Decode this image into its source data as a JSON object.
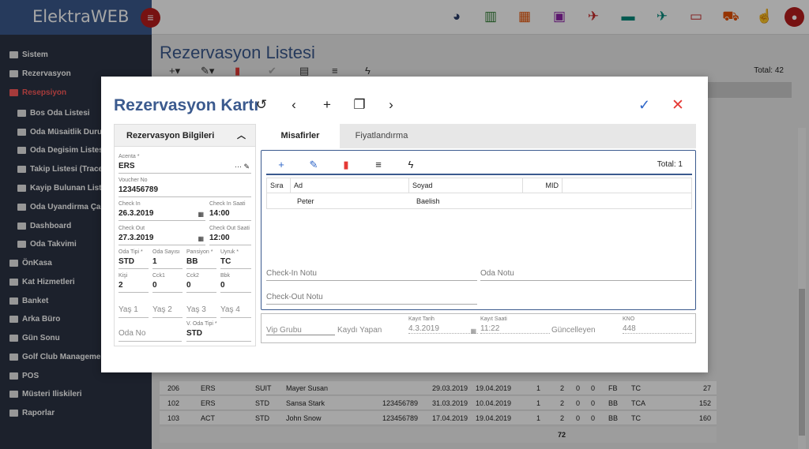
{
  "app": {
    "brand": "ElektraWEB"
  },
  "sidebar": {
    "items": [
      {
        "label": "Sistem"
      },
      {
        "label": "Rezervasyon"
      },
      {
        "label": "Resepsiyon"
      },
      {
        "label": "Bos Oda Listesi"
      },
      {
        "label": "Oda Müsaitlik Durumu"
      },
      {
        "label": "Oda Degisim Listesi"
      },
      {
        "label": "Takip Listesi (Trace)"
      },
      {
        "label": "Kayip Bulunan Listesi"
      },
      {
        "label": "Oda Uyandirma Çagrisi"
      },
      {
        "label": "Dashboard"
      },
      {
        "label": "Oda Takvimi"
      },
      {
        "label": "ÖnKasa"
      },
      {
        "label": "Kat Hizmetleri"
      },
      {
        "label": "Banket"
      },
      {
        "label": "Arka Büro"
      },
      {
        "label": "Gün Sonu"
      },
      {
        "label": "Golf Club Management"
      },
      {
        "label": "POS"
      },
      {
        "label": "Müsteri Iliskileri"
      },
      {
        "label": "Raporlar"
      }
    ]
  },
  "main": {
    "title": "Rezervasyon Listesi",
    "total": "Total: 42",
    "sum": "72"
  },
  "bg_rows": [
    {
      "c1": "206",
      "c2": "ERS",
      "c3": "SUIT",
      "c4": "Mayer Susan",
      "c5": "",
      "c6": "29.03.2019",
      "c7": "19.04.2019",
      "c8": "1",
      "c9": "2",
      "c10": "0",
      "c11": "0",
      "c12": "FB",
      "c13": "TC",
      "c14": "27"
    },
    {
      "c1": "102",
      "c2": "ERS",
      "c3": "STD",
      "c4": "Sansa Stark",
      "c5": "123456789",
      "c6": "31.03.2019",
      "c7": "10.04.2019",
      "c8": "1",
      "c9": "2",
      "c10": "0",
      "c11": "0",
      "c12": "BB",
      "c13": "TCA",
      "c14": "152"
    },
    {
      "c1": "103",
      "c2": "ACT",
      "c3": "STD",
      "c4": "John Snow",
      "c5": "123456789",
      "c6": "17.04.2019",
      "c7": "19.04.2019",
      "c8": "1",
      "c9": "2",
      "c10": "0",
      "c11": "0",
      "c12": "BB",
      "c13": "TC",
      "c14": "160"
    }
  ],
  "modal": {
    "title": "Rezervasyon Kartı",
    "left_panel": {
      "header": "Rezervasyon Bilgileri",
      "acenta_label": "Acenta *",
      "acenta": "ERS",
      "voucher_label": "Voucher No",
      "voucher": "123456789",
      "checkin_label": "Check In",
      "checkin": "26.3.2019",
      "checkin_time_label": "Check In Saati",
      "checkin_time": "14:00",
      "checkout_label": "Check Out",
      "checkout": "27.3.2019",
      "checkout_time_label": "Check Out Saati",
      "checkout_time": "12:00",
      "oda_tipi_label": "Oda Tipi *",
      "oda_tipi": "STD",
      "oda_sayisi_label": "Oda Sayısı",
      "oda_sayisi": "1",
      "pansiyon_label": "Pansiyon *",
      "pansiyon": "BB",
      "uyruk_label": "Uyruk *",
      "uyruk": "TC",
      "kisi_label": "Kişi",
      "kisi": "2",
      "cck1_label": "Cck1",
      "cck1": "0",
      "cck2_label": "Cck2",
      "cck2": "0",
      "bbk_label": "Bbk",
      "bbk": "0",
      "yas1": "Yaş 1",
      "yas2": "Yaş 2",
      "yas3": "Yaş 3",
      "yas4": "Yaş 4",
      "oda_no": "Oda No",
      "v_oda_tipi_label": "V. Oda Tipi *",
      "v_oda_tipi": "STD"
    },
    "tabs": [
      {
        "label": "Misafirler"
      },
      {
        "label": "Fiyatlandırma"
      }
    ],
    "guests": {
      "total": "Total: 1",
      "headers": [
        "Sıra",
        "Ad",
        "Soyad",
        "MID"
      ],
      "rows": [
        {
          "ad": "Peter",
          "soyad": "Baelish"
        }
      ]
    },
    "notes": {
      "checkin": "Check-In Notu",
      "oda": "Oda Notu",
      "checkout": "Check-Out Notu"
    },
    "bottom": {
      "vip": "Vip Grubu",
      "kaydi_yapan": "Kaydı Yapan",
      "kayit_tarih_label": "Kayıt Tarih",
      "kayit_tarih": "4.3.2019",
      "kayit_saati_label": "Kayıt Saati",
      "kayit_saati": "11:22",
      "guncelleyen": "Güncelleyen",
      "kno_label": "KNO",
      "kno": "448"
    }
  }
}
